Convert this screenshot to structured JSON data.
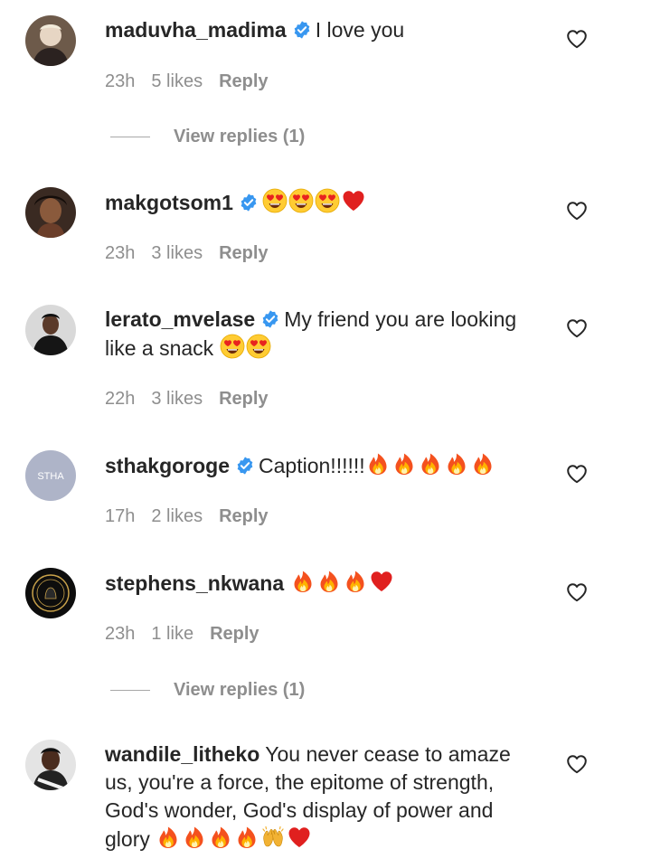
{
  "comments": [
    {
      "username": "maduvha_madima",
      "verified": true,
      "text": "I love you",
      "time": "23h",
      "likes": "5 likes",
      "reply": "Reply",
      "view_replies": "View replies (1)"
    },
    {
      "username": "makgotsom1",
      "verified": true,
      "text": "",
      "emojis": [
        "heart-eyes",
        "heart-eyes",
        "heart-eyes",
        "red-heart"
      ],
      "time": "23h",
      "likes": "3 likes",
      "reply": "Reply"
    },
    {
      "username": "lerato_mvelase",
      "verified": true,
      "text_line1": "My friend you are looking",
      "text_line2": "like a snack",
      "emojis": [
        "heart-eyes",
        "heart-eyes"
      ],
      "time": "22h",
      "likes": "3 likes",
      "reply": "Reply"
    },
    {
      "username": "sthakgoroge",
      "verified": true,
      "avatar_text": "STHA",
      "text": "Caption!!!!!!",
      "emojis": [
        "fire",
        "fire",
        "fire",
        "fire",
        "fire"
      ],
      "time": "17h",
      "likes": "2 likes",
      "reply": "Reply"
    },
    {
      "username": "stephens_nkwana",
      "verified": false,
      "text": "",
      "emojis": [
        "fire",
        "fire",
        "fire",
        "red-heart"
      ],
      "time": "23h",
      "likes": "1 like",
      "reply": "Reply",
      "view_replies": "View replies (1)"
    },
    {
      "username": "wandile_litheko",
      "verified": false,
      "text_first": "You never cease to amaze",
      "text_line2": "us, you're a force, the epitome of strength,",
      "text_line3": "God's wonder, God's display of power and",
      "text_line4": "glory",
      "emojis": [
        "fire",
        "fire",
        "fire",
        "fire",
        "raising-hands",
        "red-heart"
      ]
    }
  ],
  "icons": {
    "like": "heart-outline-icon",
    "verified": "verified-badge-icon"
  },
  "colors": {
    "verified_blue": "#3897f0",
    "meta_gray": "#8e8e8e",
    "text_dark": "#262626"
  }
}
